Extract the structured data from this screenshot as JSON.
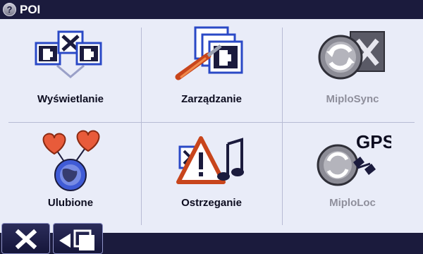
{
  "titlebar": {
    "title": "POI",
    "help_icon_glyph": "?"
  },
  "grid": {
    "items": [
      {
        "label": "Wyświetlanie",
        "icon": "poi-display-icon",
        "enabled": true
      },
      {
        "label": "Zarządzanie",
        "icon": "poi-manage-icon",
        "enabled": true
      },
      {
        "label": "MiploSync",
        "icon": "miplosync-icon",
        "enabled": false
      },
      {
        "label": "Ulubione",
        "icon": "favorites-icon",
        "enabled": true
      },
      {
        "label": "Ostrzeganie",
        "icon": "warning-icon",
        "enabled": true
      },
      {
        "label": "MiploLoc",
        "icon": "miploloc-icon",
        "enabled": false,
        "badge": "GPS"
      }
    ]
  },
  "footer": {
    "buttons": [
      {
        "icon": "close-icon"
      },
      {
        "icon": "back-icon"
      }
    ]
  },
  "colors": {
    "bar": "#1b1b3d",
    "background": "#e9ecf8",
    "accent": "#2a49c6"
  }
}
